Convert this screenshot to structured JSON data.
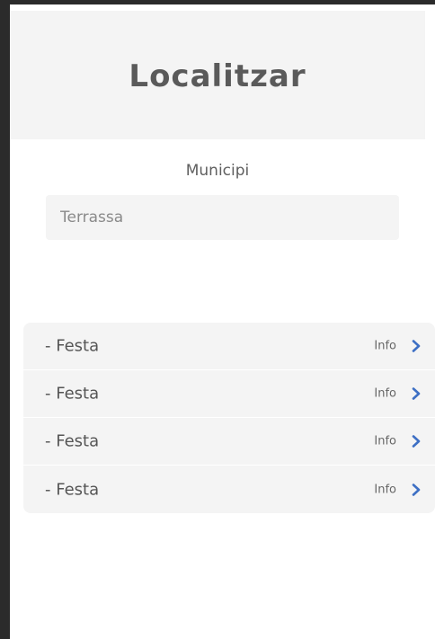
{
  "header": {
    "title": "Localitzar"
  },
  "form": {
    "label": "Municipi",
    "value": "Terrassa"
  },
  "list": {
    "items": [
      {
        "label": "- Festa",
        "action": "Info",
        "icon": "chevron-right-icon"
      },
      {
        "label": "- Festa",
        "action": "Info",
        "icon": "chevron-right-icon"
      },
      {
        "label": "- Festa",
        "action": "Info",
        "icon": "chevron-right-icon"
      },
      {
        "label": "- Festa",
        "action": "Info",
        "icon": "chevron-right-icon"
      }
    ]
  },
  "colors": {
    "accent": "#3d6fc4",
    "panel": "#f4f4f4",
    "text": "#555555"
  }
}
